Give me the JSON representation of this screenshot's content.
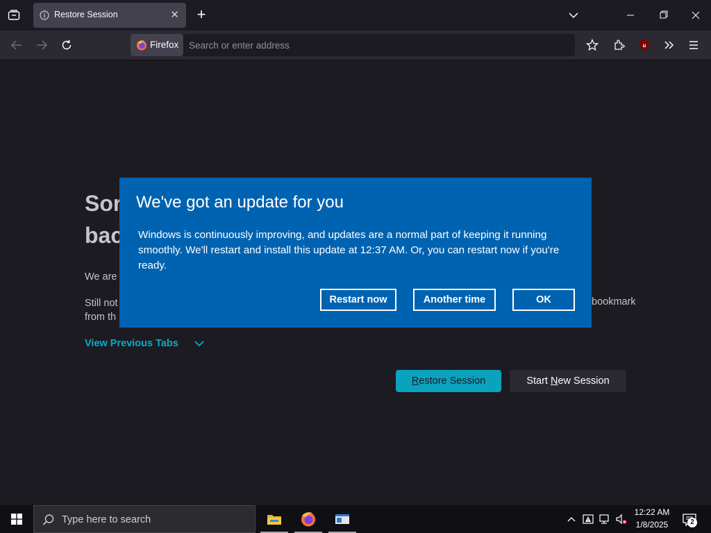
{
  "browser": {
    "tab": {
      "title": "Restore Session"
    },
    "urlbar": {
      "identity_label": "Firefox",
      "placeholder": "Search or enter address"
    }
  },
  "page": {
    "heading_line1": "Sor",
    "heading_line2": "bac",
    "para1": "We are",
    "para2_line1": "Still not",
    "para2_line1_tail": "bookmark",
    "para2_line2": "from th",
    "view_previous_tabs": "View Previous Tabs",
    "restore_button": {
      "pre": "",
      "underlined": "R",
      "post": "estore Session"
    },
    "new_session_button": {
      "pre": "Start ",
      "underlined": "N",
      "post": "ew Session"
    }
  },
  "dialog": {
    "title": "We've got an update for you",
    "body": "Windows is continuously improving, and updates are a normal part of keeping it running smoothly. We'll restart and install this update at 12:37 AM. Or, you can restart now if you're ready.",
    "buttons": {
      "restart_now": "Restart now",
      "another_time": "Another time",
      "ok": "OK"
    }
  },
  "taskbar": {
    "search_placeholder": "Type here to search",
    "clock_time": "12:22 AM",
    "clock_date": "1/8/2025",
    "notification_count": "2",
    "pinned_apps": [
      "file-explorer-icon",
      "firefox-icon",
      "window-app-icon"
    ]
  },
  "colors": {
    "dialog_bg": "#0063b1",
    "page_bg": "#1c1b22",
    "accent_cyan": "#0aa2bd",
    "link_cyan": "#00ddff"
  }
}
